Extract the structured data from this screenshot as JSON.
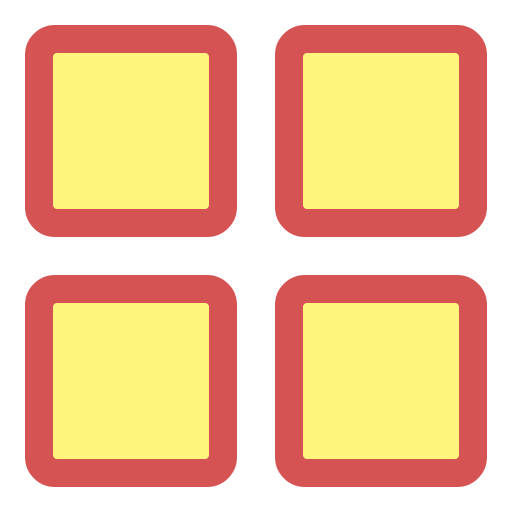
{
  "icon": {
    "name": "grid-icon",
    "tiles": [
      {
        "name": "grid-tile-top-left"
      },
      {
        "name": "grid-tile-top-right"
      },
      {
        "name": "grid-tile-bottom-left"
      },
      {
        "name": "grid-tile-bottom-right"
      }
    ]
  },
  "colors": {
    "background": "#ffffff",
    "border": "#d65353",
    "fill": "#fef57c"
  }
}
